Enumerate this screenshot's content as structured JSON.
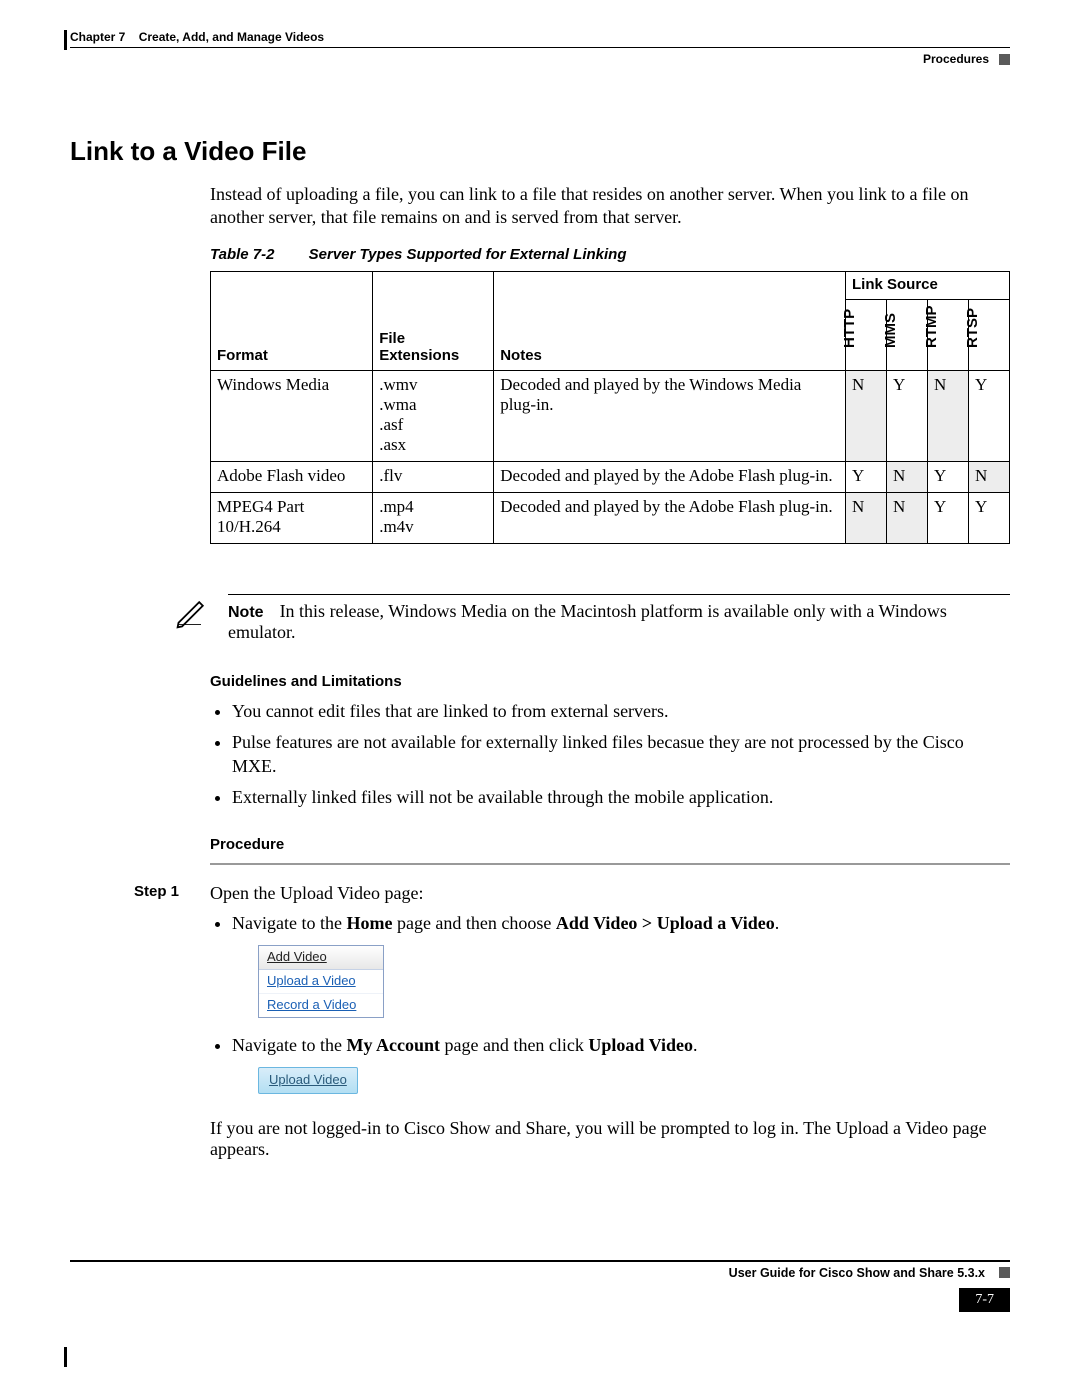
{
  "header": {
    "chapter": "Chapter 7",
    "chapter_title": "Create, Add, and Manage Videos",
    "section_label": "Procedures"
  },
  "title": "Link to a Video File",
  "intro": "Instead of uploading a file, you can link to a file that resides on another server. When you link to a file on another server, that file remains on and is served from that server.",
  "table": {
    "caption_num": "Table 7-2",
    "caption_title": "Server Types Supported for External Linking",
    "link_source_header": "Link Source",
    "columns": {
      "format": "Format",
      "ext": "File Extensions",
      "notes": "Notes"
    },
    "protocols": [
      "HTTP",
      "MMS",
      "RTMP",
      "RTSP"
    ],
    "rows": [
      {
        "format": "Windows Media",
        "ext": ".wmv\n.wma\n.asf\n.asx",
        "notes": "Decoded and played by the Windows Media plug-in.",
        "vals": [
          "N",
          "Y",
          "N",
          "Y"
        ]
      },
      {
        "format": "Adobe Flash video",
        "ext": ".flv",
        "notes": "Decoded and played by the Adobe Flash plug-in.",
        "vals": [
          "Y",
          "N",
          "Y",
          "N"
        ]
      },
      {
        "format": "MPEG4 Part 10/H.264",
        "ext": ".mp4\n.m4v",
        "notes": "Decoded and played by the Adobe Flash plug-in.",
        "vals": [
          "N",
          "N",
          "Y",
          "Y"
        ]
      }
    ]
  },
  "note": {
    "label": "Note",
    "text": "In this release, Windows Media on the Macintosh platform is available only with a Windows emulator."
  },
  "guidelines": {
    "heading": "Guidelines and Limitations",
    "items": [
      "You cannot edit files that are linked to from external servers.",
      "Pulse features are not available for externally linked files becasue they are not processed by the Cisco MXE.",
      "Externally linked files will not be available through the mobile application."
    ]
  },
  "procedure": {
    "heading": "Procedure",
    "step1": {
      "label": "Step 1",
      "intro": "Open the Upload Video page:",
      "nav1_a": "Navigate to the ",
      "nav1_b": "Home",
      "nav1_c": " page and then choose ",
      "nav1_d": "Add Video > Upload a Video",
      "nav1_e": ".",
      "dropdown": {
        "head": "Add Video",
        "items": [
          "Upload a Video",
          "Record a Video"
        ]
      },
      "nav2_a": "Navigate to the ",
      "nav2_b": "My Account",
      "nav2_c": " page and then click ",
      "nav2_d": "Upload Video",
      "nav2_e": ".",
      "btn": "Upload Video",
      "closing": "If you are not logged-in to Cisco Show and Share, you will be prompted to log in. The Upload a Video page appears."
    }
  },
  "footer": {
    "guide": "User Guide for Cisco Show and Share 5.3.x",
    "page": "7-7"
  }
}
